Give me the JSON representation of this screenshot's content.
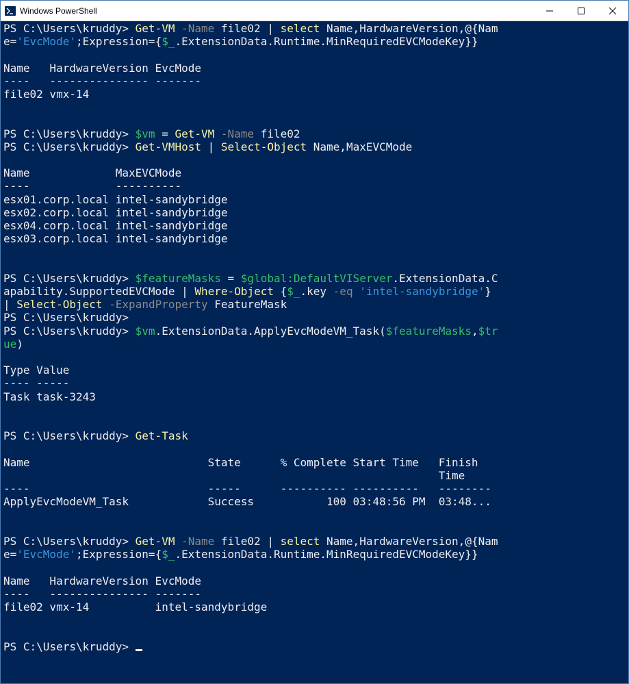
{
  "window": {
    "title": "Windows PowerShell"
  },
  "colors": {
    "console_bg": "#012456",
    "text": "#eeedf0",
    "cmdlet": "#f9f1a5",
    "param": "#8a8a8a",
    "variable": "#37be6b",
    "string": "#3a96dd"
  },
  "session": {
    "prompt": "PS C:\\Users\\kruddy>",
    "blocks": [
      {
        "type": "command",
        "text": "Get-VM -Name file02 | select Name,HardwareVersion,@{Name='EvcMode';Expression={$_.ExtensionData.Runtime.MinRequiredEVCModeKey}}"
      },
      {
        "type": "table",
        "headers": [
          "Name",
          "HardwareVersion",
          "EvcMode"
        ],
        "separators": [
          "----",
          "---------------",
          "-------"
        ],
        "rows": [
          [
            "file02",
            "vmx-14",
            ""
          ]
        ]
      },
      {
        "type": "command",
        "text": "$vm = Get-VM -Name file02"
      },
      {
        "type": "command",
        "text": "Get-VMHost | Select-Object Name,MaxEVCMode"
      },
      {
        "type": "table",
        "headers": [
          "Name",
          "MaxEVCMode"
        ],
        "separators": [
          "----",
          "----------"
        ],
        "rows": [
          [
            "esx01.corp.local",
            "intel-sandybridge"
          ],
          [
            "esx02.corp.local",
            "intel-sandybridge"
          ],
          [
            "esx04.corp.local",
            "intel-sandybridge"
          ],
          [
            "esx03.corp.local",
            "intel-sandybridge"
          ]
        ]
      },
      {
        "type": "command",
        "text": "$featureMasks = $global:DefaultVIServer.ExtensionData.Capability.SupportedEVCMode | Where-Object {$_.key -eq 'intel-sandybridge'} | Select-Object -ExpandProperty FeatureMask"
      },
      {
        "type": "command",
        "text": ""
      },
      {
        "type": "command",
        "text": "$vm.ExtensionData.ApplyEvcModeVM_Task($featureMasks,$true)"
      },
      {
        "type": "table",
        "headers": [
          "Type",
          "Value"
        ],
        "separators": [
          "----",
          "-----"
        ],
        "rows": [
          [
            "Task",
            "task-3243"
          ]
        ]
      },
      {
        "type": "command",
        "text": "Get-Task"
      },
      {
        "type": "table",
        "headers": [
          "Name",
          "State",
          "% Complete",
          "Start Time",
          "Finish Time"
        ],
        "separators": [
          "----",
          "-----",
          "----------",
          "----------",
          "--------"
        ],
        "rows": [
          [
            "ApplyEvcModeVM_Task",
            "Success",
            "100",
            "03:48:56 PM",
            "03:48..."
          ]
        ]
      },
      {
        "type": "command",
        "text": "Get-VM -Name file02 | select Name,HardwareVersion,@{Name='EvcMode';Expression={$_.ExtensionData.Runtime.MinRequiredEVCModeKey}}"
      },
      {
        "type": "table",
        "headers": [
          "Name",
          "HardwareVersion",
          "EvcMode"
        ],
        "separators": [
          "----",
          "---------------",
          "-------"
        ],
        "rows": [
          [
            "file02",
            "vmx-14",
            "intel-sandybridge"
          ]
        ]
      },
      {
        "type": "prompt_only"
      }
    ]
  },
  "rendered": {
    "l1_a": "PS C:\\Users\\kruddy> ",
    "l1_b": "Get-VM",
    "l1_c": " -Name",
    "l1_d": " file02 ",
    "l1_e": "|",
    "l1_f": " ",
    "l1_g": "select",
    "l1_h": " Name,HardwareVersion,",
    "l1_i": "@",
    "l1_j": "{Nam",
    "l2_a": "e=",
    "l2_b": "'EvcMode'",
    "l2_c": ";Expression={",
    "l2_d": "$_",
    "l2_e": ".ExtensionData.Runtime.MinRequiredEVCModeKey}}",
    "l3": "",
    "l4": "Name   HardwareVersion EvcMode",
    "l5": "----   --------------- -------",
    "l6": "file02 vmx-14",
    "l7": "",
    "l8": "",
    "l9_a": "PS C:\\Users\\kruddy> ",
    "l9_b": "$vm",
    "l9_c": " = ",
    "l9_d": "Get-VM",
    "l9_e": " -Name",
    "l9_f": " file02",
    "l10_a": "PS C:\\Users\\kruddy> ",
    "l10_b": "Get-VMHost",
    "l10_c": " ",
    "l10_d": "|",
    "l10_e": " ",
    "l10_f": "Select-Object",
    "l10_g": " Name,MaxEVCMode",
    "l11": "",
    "l12": "Name             MaxEVCMode",
    "l13": "----             ----------",
    "l14": "esx01.corp.local intel-sandybridge",
    "l15": "esx02.corp.local intel-sandybridge",
    "l16": "esx04.corp.local intel-sandybridge",
    "l17": "esx03.corp.local intel-sandybridge",
    "l18": "",
    "l19": "",
    "l20_a": "PS C:\\Users\\kruddy> ",
    "l20_b": "$featureMasks",
    "l20_c": " = ",
    "l20_d": "$global:DefaultVIServer",
    "l20_e": ".ExtensionData.C",
    "l21_a": "apability.SupportedEVCMode ",
    "l21_b": "|",
    "l21_c": " ",
    "l21_d": "Where-Object",
    "l21_e": " {",
    "l21_f": "$_",
    "l21_g": ".key ",
    "l21_h": "-eq",
    "l21_i": " ",
    "l21_j": "'intel-sandybridge'",
    "l21_k": "}",
    "l22_a": "|",
    "l22_b": " ",
    "l22_c": "Select-Object",
    "l22_d": " ",
    "l22_e": "-ExpandProperty",
    "l22_f": " FeatureMask",
    "l23": "PS C:\\Users\\kruddy>",
    "l24_a": "PS C:\\Users\\kruddy> ",
    "l24_b": "$vm",
    "l24_c": ".ExtensionData.ApplyEvcModeVM_Task(",
    "l24_d": "$featureMasks",
    "l24_e": ",",
    "l24_f": "$tr",
    "l25_a": "ue",
    "l25_b": ")",
    "l26": "",
    "l27": "Type Value",
    "l28": "---- -----",
    "l29": "Task task-3243",
    "l30": "",
    "l31": "",
    "l32_a": "PS C:\\Users\\kruddy> ",
    "l32_b": "Get-Task",
    "l33": "",
    "l34": "Name                           State      % Complete Start Time   Finish",
    "l34b": "                                                                  Time",
    "l35": "----                           -----      ---------- ----------   --------",
    "l36": "ApplyEvcModeVM_Task            Success           100 03:48:56 PM  03:48...",
    "l37": "",
    "l38": "",
    "l39_a": "PS C:\\Users\\kruddy> ",
    "l39_b": "Get-VM",
    "l39_c": " -Name",
    "l39_d": " file02 ",
    "l39_e": "|",
    "l39_f": " ",
    "l39_g": "select",
    "l39_h": " Name,HardwareVersion,",
    "l39_i": "@",
    "l39_j": "{Nam",
    "l40_a": "e=",
    "l40_b": "'EvcMode'",
    "l40_c": ";Expression={",
    "l40_d": "$_",
    "l40_e": ".ExtensionData.Runtime.MinRequiredEVCModeKey}}",
    "l41": "",
    "l42": "Name   HardwareVersion EvcMode",
    "l43": "----   --------------- -------",
    "l44": "file02 vmx-14          intel-sandybridge",
    "l45": "",
    "l46": "",
    "l47": "PS C:\\Users\\kruddy> "
  }
}
